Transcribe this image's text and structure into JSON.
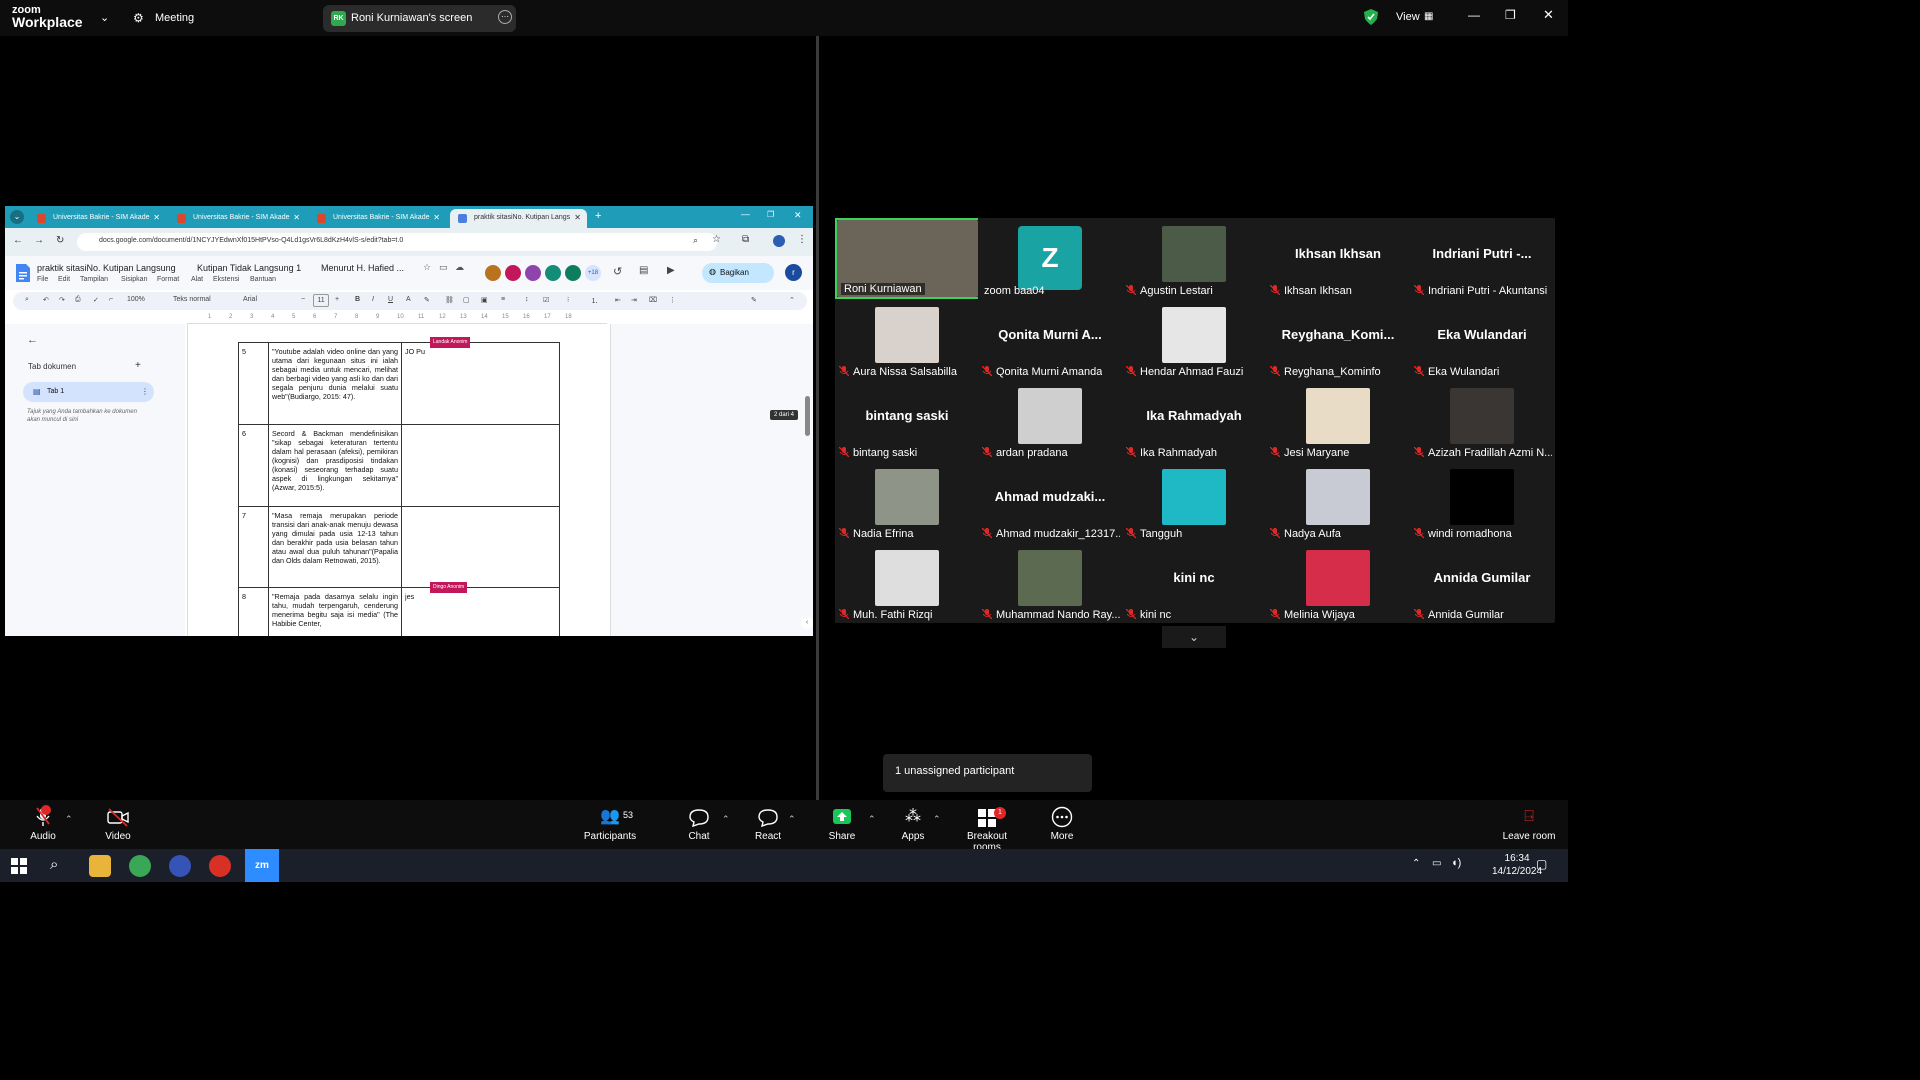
{
  "topbar": {
    "logo_line1": "zoom",
    "logo_line2": "Workplace",
    "meeting_label": "Meeting",
    "share_initials": "RK",
    "share_label": "Roni Kurniawan's screen",
    "view_label": "View"
  },
  "browser": {
    "tabs": [
      {
        "label": "Universitas Bakrie - SIM Akade"
      },
      {
        "label": "Universitas Bakrie - SIM Akade"
      },
      {
        "label": "Universitas Bakrie - SIM Akade"
      },
      {
        "label": "praktik sitasiNo. Kutipan Langs"
      }
    ],
    "url": "docs.google.com/document/d/1NCYJYEdwnXf015HtPVso-Q4Ld1gsVr6L8dKzH4vlS-s/edit?tab=t.0",
    "doc_title": "praktik sitasiNo. Kutipan Langsung",
    "doc_title2": "Kutipan Tidak Langsung 1",
    "doc_title3": "Menurut H. Hafied ...",
    "menus": [
      "File",
      "Edit",
      "Tampilan",
      "Sisipkan",
      "Format",
      "Alat",
      "Ekstensi",
      "Bantuan"
    ],
    "share_button": "Bagikan",
    "collab_count": "+18",
    "profile_initial": "r",
    "zoom": "100%",
    "style": "Teks normal",
    "font": "Arial",
    "font_size": "11",
    "side_title": "Tab dokumen",
    "tab1": "Tab 1",
    "side_hint": "Tajuk yang Anda tambahkan ke dokumen akan muncul di sini",
    "page_indicator": "2 dari 4",
    "rows": [
      {
        "num": "5",
        "text": "\"Youtube adalah video online dan yang utama dari kegunaan situs ini ialah sebagai media untuk mencari, melihat dan berbagi video yang asli ko dan dari segala penjuru dunia melalui suatu web\"(Budiargo, 2015: 47).",
        "col3": "JO Pu",
        "tag": "Landak Anonim"
      },
      {
        "num": "6",
        "text": "Secord & Backman mendefinisikan \"sikap sebagai keteraturan tertentu dalam hal perasaan (afeksi), pemikiran (kognisi) dan prasdiposisi tindakan (konasi) seseorang terhadap suatu aspek di lingkungan sekitarnya\" (Azwar, 2015:5).",
        "col3": "",
        "tag": ""
      },
      {
        "num": "7",
        "text": "\"Masa remaja merupakan periode transisi dari anak-anak menuju dewasa yang dimulai pada usia 12-13 tahun dan berakhir pada usia belasan tahun atau awal dua puluh tahunan\"(Papalia dan Olds dalam Retnowati, 2015).",
        "col3": "",
        "tag": ""
      },
      {
        "num": "8",
        "text": "\"Remaja pada dasarnya selalu ingin tahu, mudah terpengaruh, cenderung menerima begitu saja isi media\" (The Habibie Center,",
        "col3": "jes",
        "tag": "Dingo Anonim"
      }
    ]
  },
  "participants": [
    {
      "name": "Roni Kurniawan",
      "label": "Roni Kurniawan",
      "muted": false,
      "type": "photo",
      "color": "#6b6459"
    },
    {
      "name": "zoom baa04",
      "label": "zoom baa04",
      "muted": false,
      "type": "avatar",
      "initial": "Z"
    },
    {
      "name": "Agustin Lestari",
      "label": "Agustin Lestari",
      "muted": true,
      "type": "photo",
      "color": "#4c5a48"
    },
    {
      "name": "Ikhsan Ikhsan",
      "label": "Ikhsan Ikhsan",
      "muted": true,
      "type": "name"
    },
    {
      "name": "Indriani Putri -...",
      "label": "Indriani Putri - Akuntansi",
      "muted": true,
      "type": "name"
    },
    {
      "name": "Aura Nissa Salsabilla",
      "label": "Aura Nissa Salsabilla",
      "muted": true,
      "type": "photo",
      "color": "#d9d2cc"
    },
    {
      "name": "Qonita Murni A...",
      "label": "Qonita Murni Amanda",
      "muted": true,
      "type": "name"
    },
    {
      "name": "Hendar Ahmad Fauzi",
      "label": "Hendar Ahmad Fauzi",
      "muted": true,
      "type": "photo",
      "color": "#e6e6e6"
    },
    {
      "name": "Reyghana_Komi...",
      "label": "Reyghana_Kominfo",
      "muted": true,
      "type": "name"
    },
    {
      "name": "Eka Wulandari",
      "label": "Eka Wulandari",
      "muted": true,
      "type": "name"
    },
    {
      "name": "bintang saski",
      "label": "bintang saski",
      "muted": true,
      "type": "name"
    },
    {
      "name": "ardan pradana",
      "label": "ardan pradana",
      "muted": true,
      "type": "photo",
      "color": "#cfcfcf"
    },
    {
      "name": "Ika Rahmadyah",
      "label": "Ika Rahmadyah",
      "muted": true,
      "type": "name"
    },
    {
      "name": "Jesi Maryane",
      "label": "Jesi Maryane",
      "muted": true,
      "type": "photo",
      "color": "#e8dcc6"
    },
    {
      "name": "Azizah Fradillah Azmi N...",
      "label": "Azizah Fradillah Azmi N...",
      "muted": true,
      "type": "photo",
      "color": "#3a3634"
    },
    {
      "name": "Nadia Efrina",
      "label": "Nadia Efrina",
      "muted": true,
      "type": "photo",
      "color": "#8e9488"
    },
    {
      "name": "Ahmad mudzaki...",
      "label": "Ahmad mudzakir_12317...",
      "muted": true,
      "type": "name"
    },
    {
      "name": "Tangguh",
      "label": "Tangguh",
      "muted": true,
      "type": "photo",
      "color": "#1eb9c4"
    },
    {
      "name": "Nadya Aufa",
      "label": "Nadya Aufa",
      "muted": true,
      "type": "photo",
      "color": "#c9cbd4"
    },
    {
      "name": "windi romadhona",
      "label": "windi romadhona",
      "muted": true,
      "type": "photo",
      "color": "#000000"
    },
    {
      "name": "Muh. Fathi Rizqi",
      "label": "Muh. Fathi Rizqi",
      "muted": true,
      "type": "photo",
      "color": "#dedede"
    },
    {
      "name": "Muhammad Nando Ray...",
      "label": "Muhammad Nando Ray...",
      "muted": true,
      "type": "photo",
      "color": "#5c6a52"
    },
    {
      "name": "kini nc",
      "label": "kini nc",
      "muted": true,
      "type": "name"
    },
    {
      "name": "Melinia Wijaya",
      "label": "Melinia Wijaya",
      "muted": true,
      "type": "photo",
      "color": "#d62e4a"
    },
    {
      "name": "Annida Gumilar",
      "label": "Annida Gumilar",
      "muted": true,
      "type": "name"
    }
  ],
  "unassigned": "1 unassigned participant",
  "toolbar": {
    "audio": "Audio",
    "video": "Video",
    "participants": "Participants",
    "participants_count": "53",
    "chat": "Chat",
    "react": "React",
    "share": "Share",
    "apps": "Apps",
    "breakout": "Breakout rooms",
    "breakout_badge": "1",
    "more": "More",
    "leave": "Leave room"
  },
  "taskbar": {
    "time": "16:34",
    "date": "14/12/2024"
  },
  "colors": {
    "accent_green": "#3bd15a",
    "share_green": "#19c65a",
    "mute_red": "#e02828",
    "docs_blue": "#1f9cb8"
  }
}
